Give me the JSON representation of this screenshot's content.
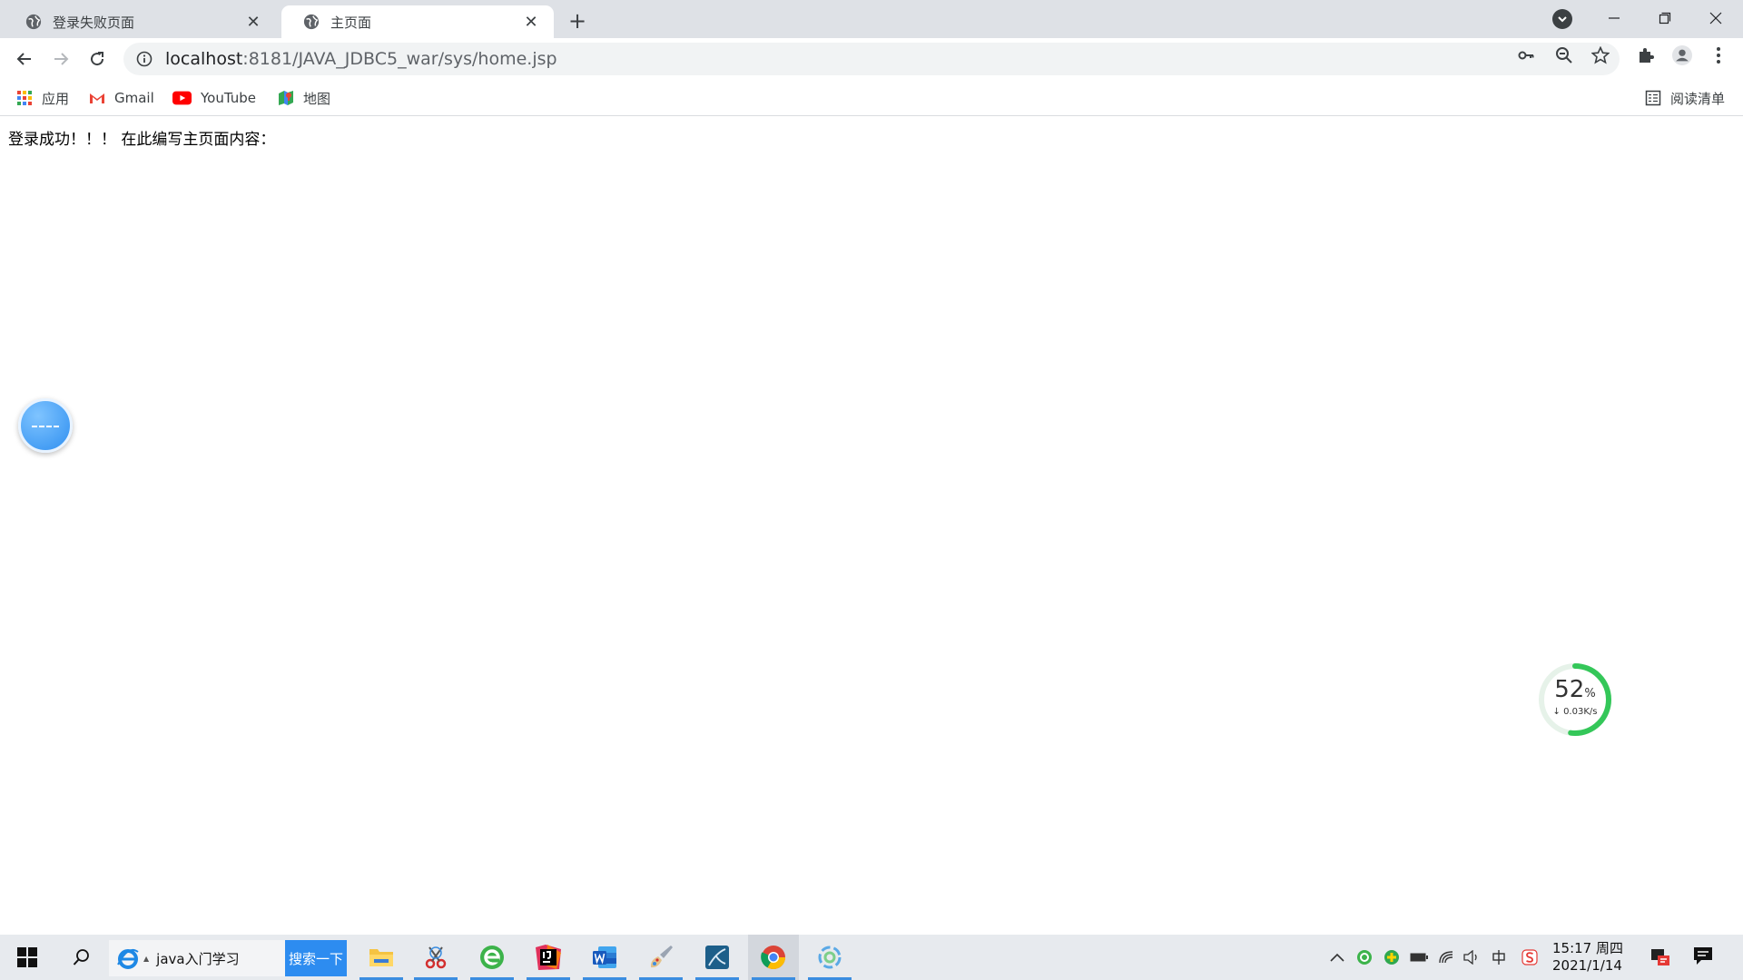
{
  "tabs": [
    {
      "title": "登录失败页面",
      "active": false
    },
    {
      "title": "主页面",
      "active": true
    }
  ],
  "toolbar": {
    "url_host": "localhost",
    "url_rest": ":8181/JAVA_JDBC5_war/sys/home.jsp"
  },
  "bookmarks": [
    {
      "label": "应用",
      "icon": "apps-grid-icon"
    },
    {
      "label": "Gmail",
      "icon": "gmail-icon"
    },
    {
      "label": "YouTube",
      "icon": "youtube-icon"
    },
    {
      "label": "地图",
      "icon": "maps-icon"
    }
  ],
  "reading_list_label": "阅读清单",
  "page": {
    "message": "登录成功！！！  在此编写主页面内容："
  },
  "speed_widget": {
    "percent_value": 52,
    "percent": "52",
    "percent_unit": "%",
    "rate": "↓ 0.03K/s"
  },
  "taskbar": {
    "search_query": "java入门学习",
    "search_button": "搜索一下",
    "clock_time": "15:17 周四",
    "clock_date": "2021/1/14"
  },
  "colors": {
    "tab_strip": "#dee1e6",
    "accent_blue": "#2d8cf0",
    "progress_green": "#34c759"
  }
}
